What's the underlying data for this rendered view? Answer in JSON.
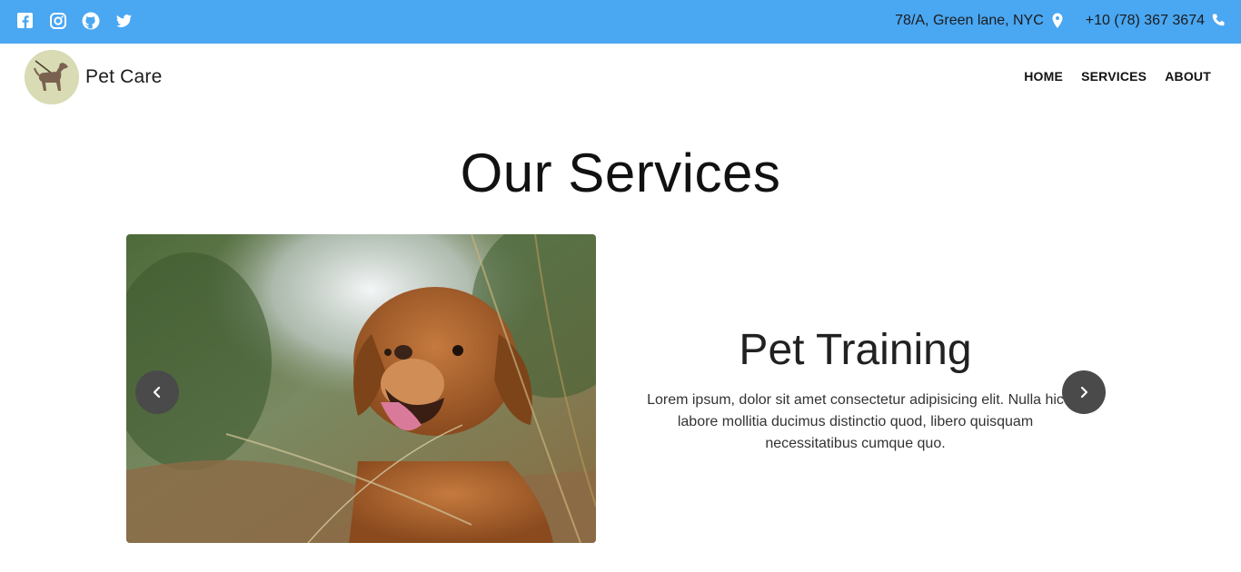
{
  "topbar": {
    "social_icons": [
      "facebook-icon",
      "instagram-icon",
      "github-icon",
      "twitter-icon"
    ],
    "address": "78/A, Green lane, NYC",
    "phone": "+10 (78) 367 3674",
    "background_color": "#4aa7f2"
  },
  "navbar": {
    "brand_name": "Pet Care",
    "links": [
      "HOME",
      "SERVICES",
      "ABOUT"
    ]
  },
  "services": {
    "title": "Our Services",
    "slide": {
      "title": "Pet Training",
      "text": "Lorem ipsum, dolor sit amet consectetur adipisicing elit. Nulla hic labore mollitia ducimus distinctio quod, libero quisquam necessitatibus cumque quo."
    }
  }
}
